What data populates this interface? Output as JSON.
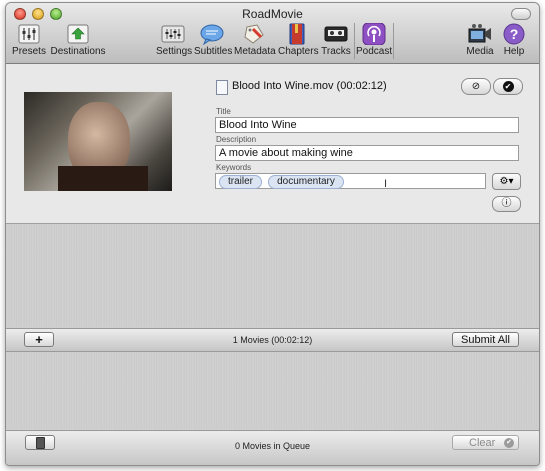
{
  "window": {
    "title": "RoadMovie"
  },
  "toolbar": {
    "items": [
      {
        "label": "Presets",
        "icon": "presets-icon"
      },
      {
        "label": "Destinations",
        "icon": "destinations-icon"
      },
      {
        "label": "Settings",
        "icon": "settings-icon"
      },
      {
        "label": "Subtitles",
        "icon": "subtitles-icon"
      },
      {
        "label": "Metadata",
        "icon": "metadata-icon"
      },
      {
        "label": "Chapters",
        "icon": "chapters-icon"
      },
      {
        "label": "Tracks",
        "icon": "tracks-icon"
      },
      {
        "label": "Podcast",
        "icon": "podcast-icon"
      },
      {
        "label": "Media",
        "icon": "media-icon"
      },
      {
        "label": "Help",
        "icon": "help-icon"
      }
    ]
  },
  "movie": {
    "filename": "Blood Into Wine.mov (00:02:12)",
    "title_label": "Title",
    "title_value": "Blood Into Wine",
    "description_label": "Description",
    "description_value": "A movie about making wine",
    "keywords_label": "Keywords",
    "keywords": [
      "trailer",
      "documentary"
    ]
  },
  "movies_bar": {
    "add_label": "+",
    "status": "1 Movies (00:02:12)",
    "submit_label": "Submit All"
  },
  "queue_bar": {
    "status": "0 Movies in Queue",
    "clear_label": "Clear"
  },
  "colors": {
    "accent_purple": "#8e4fc2",
    "token_blue": "#dbe4f3"
  }
}
